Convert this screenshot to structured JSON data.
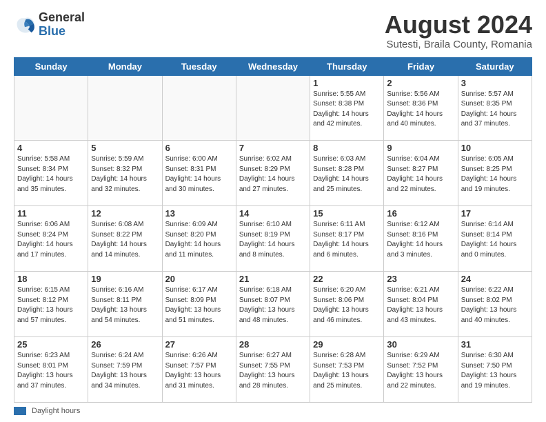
{
  "logo": {
    "general": "General",
    "blue": "Blue"
  },
  "header": {
    "title": "August 2024",
    "subtitle": "Sutesti, Braila County, Romania"
  },
  "days_of_week": [
    "Sunday",
    "Monday",
    "Tuesday",
    "Wednesday",
    "Thursday",
    "Friday",
    "Saturday"
  ],
  "weeks": [
    [
      {
        "num": "",
        "info": ""
      },
      {
        "num": "",
        "info": ""
      },
      {
        "num": "",
        "info": ""
      },
      {
        "num": "",
        "info": ""
      },
      {
        "num": "1",
        "info": "Sunrise: 5:55 AM\nSunset: 8:38 PM\nDaylight: 14 hours\nand 42 minutes."
      },
      {
        "num": "2",
        "info": "Sunrise: 5:56 AM\nSunset: 8:36 PM\nDaylight: 14 hours\nand 40 minutes."
      },
      {
        "num": "3",
        "info": "Sunrise: 5:57 AM\nSunset: 8:35 PM\nDaylight: 14 hours\nand 37 minutes."
      }
    ],
    [
      {
        "num": "4",
        "info": "Sunrise: 5:58 AM\nSunset: 8:34 PM\nDaylight: 14 hours\nand 35 minutes."
      },
      {
        "num": "5",
        "info": "Sunrise: 5:59 AM\nSunset: 8:32 PM\nDaylight: 14 hours\nand 32 minutes."
      },
      {
        "num": "6",
        "info": "Sunrise: 6:00 AM\nSunset: 8:31 PM\nDaylight: 14 hours\nand 30 minutes."
      },
      {
        "num": "7",
        "info": "Sunrise: 6:02 AM\nSunset: 8:29 PM\nDaylight: 14 hours\nand 27 minutes."
      },
      {
        "num": "8",
        "info": "Sunrise: 6:03 AM\nSunset: 8:28 PM\nDaylight: 14 hours\nand 25 minutes."
      },
      {
        "num": "9",
        "info": "Sunrise: 6:04 AM\nSunset: 8:27 PM\nDaylight: 14 hours\nand 22 minutes."
      },
      {
        "num": "10",
        "info": "Sunrise: 6:05 AM\nSunset: 8:25 PM\nDaylight: 14 hours\nand 19 minutes."
      }
    ],
    [
      {
        "num": "11",
        "info": "Sunrise: 6:06 AM\nSunset: 8:24 PM\nDaylight: 14 hours\nand 17 minutes."
      },
      {
        "num": "12",
        "info": "Sunrise: 6:08 AM\nSunset: 8:22 PM\nDaylight: 14 hours\nand 14 minutes."
      },
      {
        "num": "13",
        "info": "Sunrise: 6:09 AM\nSunset: 8:20 PM\nDaylight: 14 hours\nand 11 minutes."
      },
      {
        "num": "14",
        "info": "Sunrise: 6:10 AM\nSunset: 8:19 PM\nDaylight: 14 hours\nand 8 minutes."
      },
      {
        "num": "15",
        "info": "Sunrise: 6:11 AM\nSunset: 8:17 PM\nDaylight: 14 hours\nand 6 minutes."
      },
      {
        "num": "16",
        "info": "Sunrise: 6:12 AM\nSunset: 8:16 PM\nDaylight: 14 hours\nand 3 minutes."
      },
      {
        "num": "17",
        "info": "Sunrise: 6:14 AM\nSunset: 8:14 PM\nDaylight: 14 hours\nand 0 minutes."
      }
    ],
    [
      {
        "num": "18",
        "info": "Sunrise: 6:15 AM\nSunset: 8:12 PM\nDaylight: 13 hours\nand 57 minutes."
      },
      {
        "num": "19",
        "info": "Sunrise: 6:16 AM\nSunset: 8:11 PM\nDaylight: 13 hours\nand 54 minutes."
      },
      {
        "num": "20",
        "info": "Sunrise: 6:17 AM\nSunset: 8:09 PM\nDaylight: 13 hours\nand 51 minutes."
      },
      {
        "num": "21",
        "info": "Sunrise: 6:18 AM\nSunset: 8:07 PM\nDaylight: 13 hours\nand 48 minutes."
      },
      {
        "num": "22",
        "info": "Sunrise: 6:20 AM\nSunset: 8:06 PM\nDaylight: 13 hours\nand 46 minutes."
      },
      {
        "num": "23",
        "info": "Sunrise: 6:21 AM\nSunset: 8:04 PM\nDaylight: 13 hours\nand 43 minutes."
      },
      {
        "num": "24",
        "info": "Sunrise: 6:22 AM\nSunset: 8:02 PM\nDaylight: 13 hours\nand 40 minutes."
      }
    ],
    [
      {
        "num": "25",
        "info": "Sunrise: 6:23 AM\nSunset: 8:01 PM\nDaylight: 13 hours\nand 37 minutes."
      },
      {
        "num": "26",
        "info": "Sunrise: 6:24 AM\nSunset: 7:59 PM\nDaylight: 13 hours\nand 34 minutes."
      },
      {
        "num": "27",
        "info": "Sunrise: 6:26 AM\nSunset: 7:57 PM\nDaylight: 13 hours\nand 31 minutes."
      },
      {
        "num": "28",
        "info": "Sunrise: 6:27 AM\nSunset: 7:55 PM\nDaylight: 13 hours\nand 28 minutes."
      },
      {
        "num": "29",
        "info": "Sunrise: 6:28 AM\nSunset: 7:53 PM\nDaylight: 13 hours\nand 25 minutes."
      },
      {
        "num": "30",
        "info": "Sunrise: 6:29 AM\nSunset: 7:52 PM\nDaylight: 13 hours\nand 22 minutes."
      },
      {
        "num": "31",
        "info": "Sunrise: 6:30 AM\nSunset: 7:50 PM\nDaylight: 13 hours\nand 19 minutes."
      }
    ]
  ],
  "footer": {
    "legend_label": "Daylight hours"
  }
}
